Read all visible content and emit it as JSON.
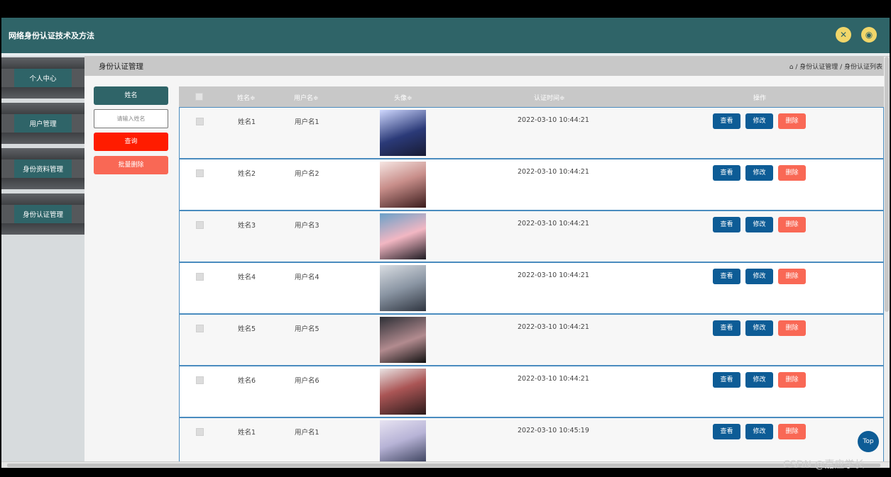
{
  "app": {
    "title": "网络身份认证技术及方法"
  },
  "header": {
    "icons": [
      "fullscreen-icon",
      "user-icon"
    ]
  },
  "sidebar": {
    "items": [
      {
        "label": "个人中心"
      },
      {
        "label": "用户管理"
      },
      {
        "label": "身份资料管理"
      },
      {
        "label": "身份认证管理"
      }
    ]
  },
  "page": {
    "title": "身份认证管理",
    "breadcrumb": {
      "home_icon": "home-icon",
      "path": "/ 身份认证管理 / 身份认证列表"
    }
  },
  "filter": {
    "field_label": "姓名",
    "input_placeholder": "请输入姓名",
    "query_button": "查询",
    "batch_delete_button": "批量删除"
  },
  "table": {
    "headers": {
      "name": "姓名≑",
      "username": "用户名≑",
      "avatar": "头像≑",
      "time": "认证时间≑",
      "actions": "操作"
    },
    "action_labels": {
      "view": "查看",
      "edit": "修改",
      "delete": "删除"
    },
    "rows": [
      {
        "name": "姓名1",
        "username": "用户名1",
        "time": "2022-03-10 10:44:21"
      },
      {
        "name": "姓名2",
        "username": "用户名2",
        "time": "2022-03-10 10:44:21"
      },
      {
        "name": "姓名3",
        "username": "用户名3",
        "time": "2022-03-10 10:44:21"
      },
      {
        "name": "姓名4",
        "username": "用户名4",
        "time": "2022-03-10 10:44:21"
      },
      {
        "name": "姓名5",
        "username": "用户名5",
        "time": "2022-03-10 10:44:21"
      },
      {
        "name": "姓名6",
        "username": "用户名6",
        "time": "2022-03-10 10:44:21"
      },
      {
        "name": "姓名1",
        "username": "用户名1",
        "time": "2022-03-10 10:45:19"
      }
    ]
  },
  "top_button": {
    "label": "Top"
  },
  "watermark": "CSDN @嘉应学长",
  "colors": {
    "header": "#2f6468",
    "primary": "#0d5c96",
    "danger": "#f96855",
    "query": "#ff1c00",
    "batch": "#f96855"
  }
}
